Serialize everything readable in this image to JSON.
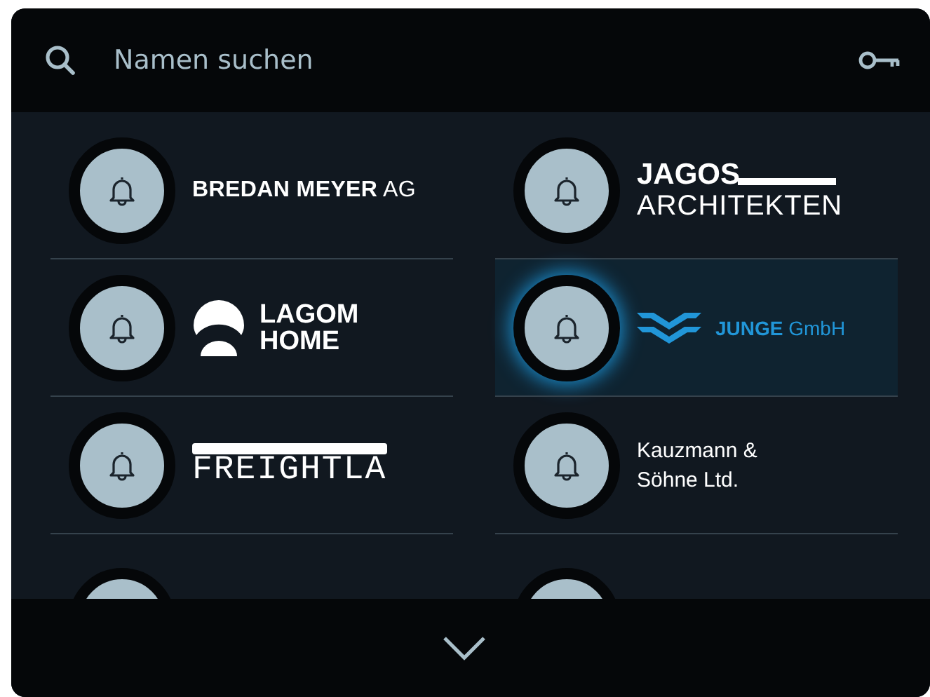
{
  "search": {
    "placeholder": "Namen suchen"
  },
  "entries": [
    {
      "kind": "wordmark",
      "lines": [
        "**BREDAN MEYER** AG"
      ],
      "selected": false
    },
    {
      "kind": "stacked",
      "lines": [
        "JAGOS",
        "ARCHITEKTEN"
      ],
      "selected": false
    },
    {
      "kind": "emblem",
      "lines": [
        "LAGOM",
        "HOME"
      ],
      "selected": false
    },
    {
      "kind": "waves",
      "lines": [
        "**JUNGE** GmbH"
      ],
      "selected": true
    },
    {
      "kind": "stencil",
      "lines": [
        "FREIGHTLA"
      ],
      "selected": false
    },
    {
      "kind": "plain",
      "lines": [
        "Kauzmann &",
        "Söhne Ltd."
      ],
      "selected": false
    },
    {
      "kind": "partial",
      "selected": false
    },
    {
      "kind": "partial",
      "selected": false
    }
  ]
}
